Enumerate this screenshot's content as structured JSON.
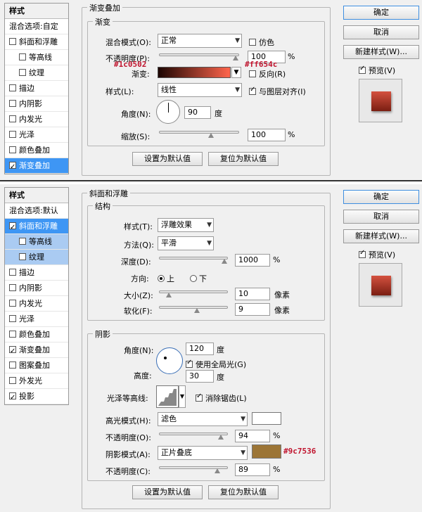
{
  "top": {
    "styles_title": "样式",
    "blend_options": "混合选项:自定",
    "side_items": [
      {
        "label": "斜面和浮雕",
        "checked": false,
        "sub": false,
        "state": ""
      },
      {
        "label": "等高线",
        "checked": false,
        "sub": true,
        "state": ""
      },
      {
        "label": "纹理",
        "checked": false,
        "sub": true,
        "state": ""
      },
      {
        "label": "描边",
        "checked": false,
        "sub": false,
        "state": ""
      },
      {
        "label": "内阴影",
        "checked": false,
        "sub": false,
        "state": ""
      },
      {
        "label": "内发光",
        "checked": false,
        "sub": false,
        "state": ""
      },
      {
        "label": "光泽",
        "checked": false,
        "sub": false,
        "state": ""
      },
      {
        "label": "颜色叠加",
        "checked": false,
        "sub": false,
        "state": ""
      },
      {
        "label": "渐变叠加",
        "checked": true,
        "sub": false,
        "state": "sel"
      }
    ],
    "outer_title": "渐变叠加",
    "inner_title": "渐变",
    "blend_mode_label": "混合模式(O):",
    "blend_mode_value": "正常",
    "dither_label": "仿色",
    "opacity_label": "不透明度(P):",
    "opacity_value": "100",
    "pct": "%",
    "gradient_label": "渐变:",
    "reverse_label": "反向(R)",
    "style_label": "样式(L):",
    "style_value": "线性",
    "align_label": "与图层对齐(I)",
    "angle_label": "角度(N):",
    "angle_value": "90",
    "degree": "度",
    "scale_label": "缩放(S):",
    "scale_value": "100",
    "set_default": "设置为默认值",
    "reset_default": "复位为默认值",
    "ok": "确定",
    "cancel": "取消",
    "new_style": "新建样式(W)...",
    "preview_label": "预览(V)",
    "annot_left": "#1c0502",
    "annot_right": "#ff654c",
    "gradient_from": "#1c0502",
    "gradient_to": "#ff654c",
    "opacity_level": 100,
    "scale_level": 66
  },
  "bottom": {
    "styles_title": "样式",
    "blend_options": "混合选项:默认",
    "side_items": [
      {
        "label": "斜面和浮雕",
        "checked": true,
        "sub": false,
        "state": "sel"
      },
      {
        "label": "等高线",
        "checked": false,
        "sub": true,
        "state": "subsel"
      },
      {
        "label": "纹理",
        "checked": false,
        "sub": true,
        "state": "subsel"
      },
      {
        "label": "描边",
        "checked": false,
        "sub": false,
        "state": ""
      },
      {
        "label": "内阴影",
        "checked": false,
        "sub": false,
        "state": ""
      },
      {
        "label": "内发光",
        "checked": false,
        "sub": false,
        "state": ""
      },
      {
        "label": "光泽",
        "checked": false,
        "sub": false,
        "state": ""
      },
      {
        "label": "颜色叠加",
        "checked": false,
        "sub": false,
        "state": ""
      },
      {
        "label": "渐变叠加",
        "checked": true,
        "sub": false,
        "state": ""
      },
      {
        "label": "图案叠加",
        "checked": false,
        "sub": false,
        "state": ""
      },
      {
        "label": "外发光",
        "checked": false,
        "sub": false,
        "state": ""
      },
      {
        "label": "投影",
        "checked": true,
        "sub": false,
        "state": ""
      }
    ],
    "outer_title": "斜面和浮雕",
    "structure_title": "结构",
    "style_label": "样式(T):",
    "style_value": "浮雕效果",
    "method_label": "方法(Q):",
    "method_value": "平滑",
    "depth_label": "深度(D):",
    "depth_value": "1000",
    "pct": "%",
    "direction_label": "方向:",
    "dir_up": "上",
    "dir_down": "下",
    "size_label": "大小(Z):",
    "size_value": "10",
    "px": "像素",
    "soften_label": "软化(F):",
    "soften_value": "9",
    "shading_title": "阴影",
    "angle_label": "角度(N):",
    "angle_value": "120",
    "degree": "度",
    "global_light": "使用全局光(G)",
    "altitude_label": "高度:",
    "altitude_value": "30",
    "gloss_label": "光泽等高线:",
    "antialias": "消除锯齿(L)",
    "highlight_label": "高光模式(H):",
    "highlight_value": "滤色",
    "hl_opacity_label": "不透明度(O):",
    "hl_opacity_value": "94",
    "shadow_label": "阴影模式(A):",
    "shadow_value": "正片叠底",
    "sh_opacity_label": "不透明度(C):",
    "sh_opacity_value": "89",
    "set_default": "设置为默认值",
    "reset_default": "复位为默认值",
    "ok": "确定",
    "cancel": "取消",
    "new_style": "新建样式(W)...",
    "preview_label": "预览(V)",
    "annot_shadow": "#9c7536",
    "highlight_color": "#ffffff",
    "shadow_color": "#9c7536",
    "depth_level": 100,
    "size_level": 10,
    "soften_level": 56,
    "hl_opacity_level": 94,
    "sh_opacity_level": 89
  }
}
